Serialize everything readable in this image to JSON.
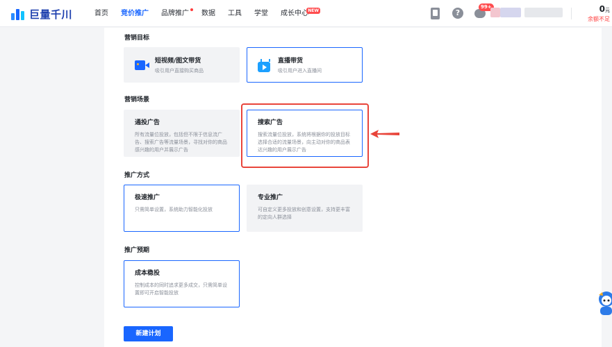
{
  "header": {
    "logo_text": "巨量千川",
    "nav": [
      {
        "label": "首页",
        "active": false
      },
      {
        "label": "竞价推广",
        "active": true
      },
      {
        "label": "品牌推广",
        "active": false,
        "dot": true
      },
      {
        "label": "数据",
        "active": false
      },
      {
        "label": "工具",
        "active": false
      },
      {
        "label": "学堂",
        "active": false
      },
      {
        "label": "成长中心",
        "active": false,
        "badge": "NEW"
      }
    ],
    "message_badge": "99+",
    "balance": {
      "amount": "0",
      "unit": "元",
      "warning": "余额不足"
    }
  },
  "sections": {
    "goal": {
      "title": "营销目标",
      "cards": [
        {
          "title": "短视频/图文带货",
          "desc": "吸引用户直接购买商品",
          "icon": "video-icon",
          "selected": false
        },
        {
          "title": "直播带货",
          "desc": "吸引用户进入直播间",
          "icon": "live-tv-icon",
          "selected": true
        }
      ]
    },
    "scene": {
      "title": "营销场景",
      "cards": [
        {
          "title": "通投广告",
          "desc": "所有流量位投放，包括但不限于信息流广告、搜索广告等流量场景，寻找对你的商品感兴趣的用户并展示广告",
          "selected": false
        },
        {
          "title": "搜索广告",
          "desc": "搜索流量位投放，系统将根据你的投放目标选择合适的流量场景，向主动对你的商品表达兴趣的用户展示广告",
          "selected": true
        }
      ]
    },
    "method": {
      "title": "推广方式",
      "cards": [
        {
          "title": "极速推广",
          "desc": "只需简单设置，系统助力智能化投放",
          "selected": true
        },
        {
          "title": "专业推广",
          "desc": "可自定义更多投放和创意设置，支持更丰富的定向人群选择",
          "selected": false
        }
      ]
    },
    "expectation": {
      "title": "推广预期",
      "cards": [
        {
          "title": "成本稳投",
          "desc": "控制成本的同时追求更多成交，只需简单设置即可开启智能投放",
          "selected": true
        }
      ]
    }
  },
  "actions": {
    "new_plan": "新建计划"
  },
  "colors": {
    "accent": "#1966ff",
    "annotation": "#e8443a",
    "warning": "#ff3b3b"
  }
}
